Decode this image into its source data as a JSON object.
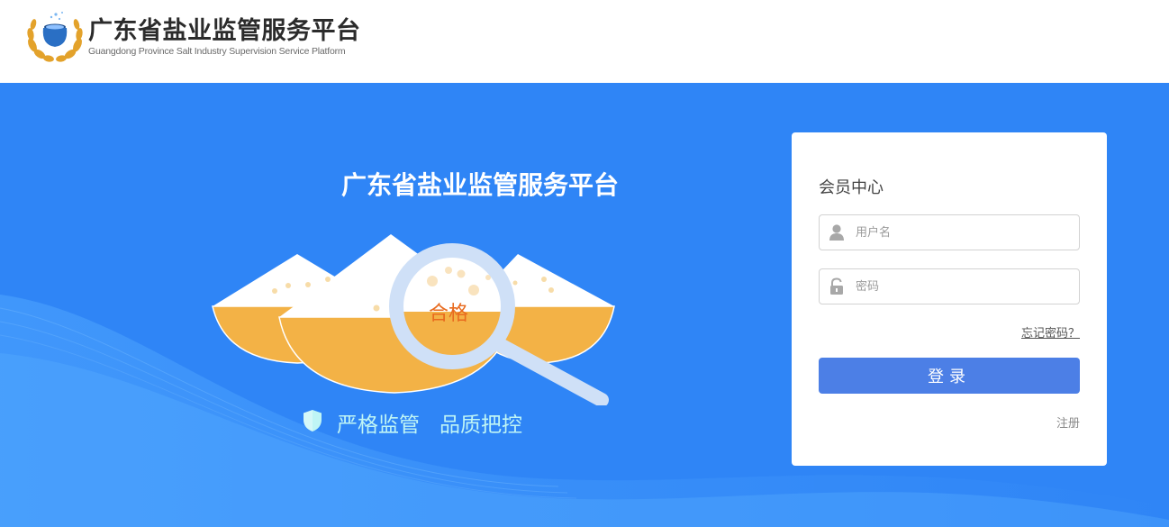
{
  "header": {
    "title": "广东省盐业监管服务平台",
    "subtitle": "Guangdong Province Salt Industry Supervision Service Platform"
  },
  "hero": {
    "title": "广东省盐业监管服务平台",
    "stamp": "合格",
    "slogan_part1": "严格监管",
    "slogan_part2": "品质把控"
  },
  "login": {
    "title": "会员中心",
    "username_placeholder": "用户名",
    "username_value": "",
    "password_placeholder": "密码",
    "password_value": "",
    "forgot_label": "忘记密码？",
    "login_label": "登录",
    "register_label": "注册"
  },
  "icons": {
    "logo": "salt-pot-laurel-emblem",
    "user_field": "user-icon",
    "password_field": "lock-icon",
    "slogan": "shield-icon"
  },
  "colors": {
    "hero_background": "#2f85f6",
    "login_button": "#4c7fe6",
    "stamp_text": "#e86a1e",
    "slogan_text": "#bff5f5",
    "salt_bowl": "#f3b246"
  }
}
